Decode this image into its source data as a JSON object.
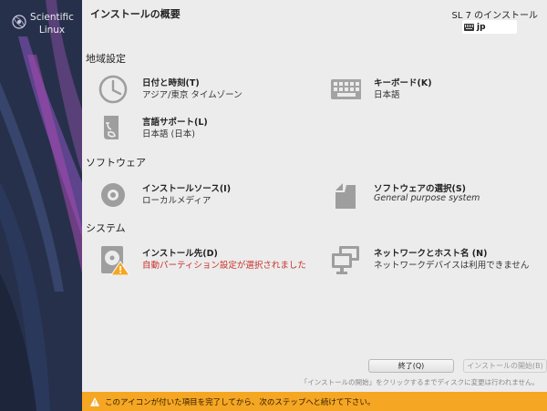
{
  "sidebar": {
    "brand_line1": "Scientific",
    "brand_line2": "Linux"
  },
  "header": {
    "title": "インストールの概要",
    "product": "SL 7 のインストール",
    "keyboard_layout": "jp"
  },
  "sections": [
    {
      "label": "地域設定",
      "spokes": [
        {
          "title": "日付と時刻(T)",
          "status": "アジア/東京 タイムゾーン",
          "icon": "clock-icon"
        },
        {
          "title": "キーボード(K)",
          "status": "日本語",
          "icon": "keyboard-icon"
        },
        {
          "title": "言語サポート(L)",
          "status": "日本語 (日本)",
          "icon": "language-icon"
        }
      ]
    },
    {
      "label": "ソフトウェア",
      "spokes": [
        {
          "title": "インストールソース(I)",
          "status": "ローカルメディア",
          "icon": "disc-icon"
        },
        {
          "title": "ソフトウェアの選択(S)",
          "status": "General purpose system",
          "icon": "package-icon"
        }
      ]
    },
    {
      "label": "システム",
      "spokes": [
        {
          "title": "インストール先(D)",
          "status": "自動パーティション設定が選択されました",
          "icon": "harddisk-warning-icon"
        },
        {
          "title": "ネットワークとホスト名 (N)",
          "status": "ネットワークデバイスは利用できません",
          "icon": "network-icon"
        }
      ]
    }
  ],
  "buttons": {
    "quit": "終了(Q)",
    "begin": "インストールの開始(B)"
  },
  "hint": "「インストールの開始」をクリックするまでディスクに変更は行われません。",
  "warning_bar": {
    "text": "このアイコンが付いた項目を完了してから、次のステップへと続けて下さい。",
    "color": "#f5a623"
  },
  "colors": {
    "warning_text": "#c8312b",
    "icon_gray": "#9e9e9e"
  }
}
